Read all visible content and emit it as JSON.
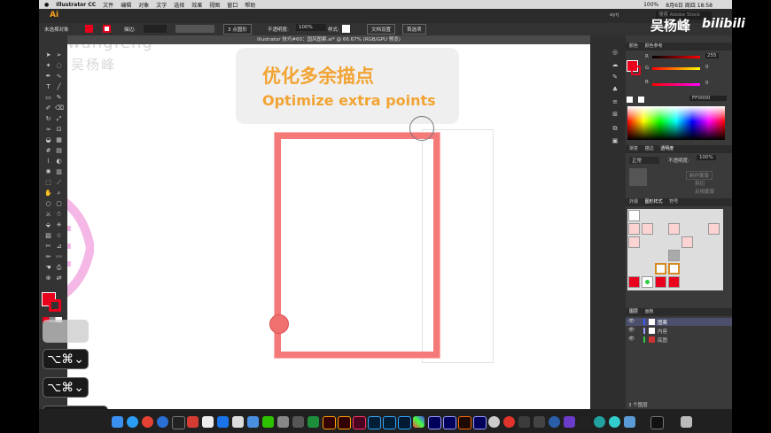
{
  "menu": {
    "app_name": "Illustrator CC",
    "items": [
      "文件",
      "编辑",
      "对象",
      "文字",
      "选择",
      "效果",
      "视图",
      "窗口",
      "帮助"
    ],
    "status": "100%",
    "clock": "8月6日 周四 18:58"
  },
  "app_toolbar": {
    "logo": "Ai",
    "search_placeholder": "搜索 Adobe Stock",
    "workspace": "ayrj"
  },
  "control_bar": {
    "selection_label": "未选择对象",
    "stroke_label": "描边:",
    "brush_label": "3 点圆形",
    "opacity_label": "不透明度:",
    "opacity_value": "100%",
    "style_label": "样式:",
    "doc_setup": "文档设置",
    "prefs": "首选项"
  },
  "document_tab": {
    "title": "illustrator 技巧#60：国风图案.ai* @ 66.67% (RGB/GPU 预览)"
  },
  "watermark": {
    "username": "wangfeng",
    "name": "吴杨峰"
  },
  "overlay": {
    "channel_name": "吴杨峰",
    "channel_logo": "bilibili",
    "title_zh": "优化多余描点",
    "title_en": "Optimize extra points"
  },
  "color_panel": {
    "tabs": [
      "颜色",
      "颜色参考"
    ],
    "r_label": "R",
    "r_value": "255",
    "g_label": "G",
    "g_value": "0",
    "b_label": "B",
    "b_value": "0",
    "hex_value": "FF0000"
  },
  "transparency_panel": {
    "tabs": [
      "渐变",
      "描边",
      "透明度"
    ],
    "mode": "正常",
    "opacity_label": "不透明度:",
    "opacity_value": "100%",
    "make_mask": "制作蒙版",
    "clip": "剪切",
    "invert": "反相蒙版"
  },
  "styles_panel": {
    "tabs": [
      "外观",
      "图形样式",
      "符号"
    ]
  },
  "layers_panel": {
    "tabs": [
      "图层",
      "画板"
    ],
    "layers": [
      {
        "name": "图案",
        "color": "#3a5bff"
      },
      {
        "name": "内容",
        "color": "#9b9bff"
      },
      {
        "name": "底图",
        "color": "#2ecc40"
      }
    ],
    "footer": "3 个图层"
  },
  "shortcuts": [
    "⌥⌘⌄",
    "⌥⌘⌄",
    "⌘⎵⎵⎵⎵⎵"
  ],
  "colors": {
    "accent_orange": "#f2a433",
    "frame_red": "#f47a7a",
    "fill_red": "#e8001c",
    "artboard_bg": "#ffffff"
  }
}
